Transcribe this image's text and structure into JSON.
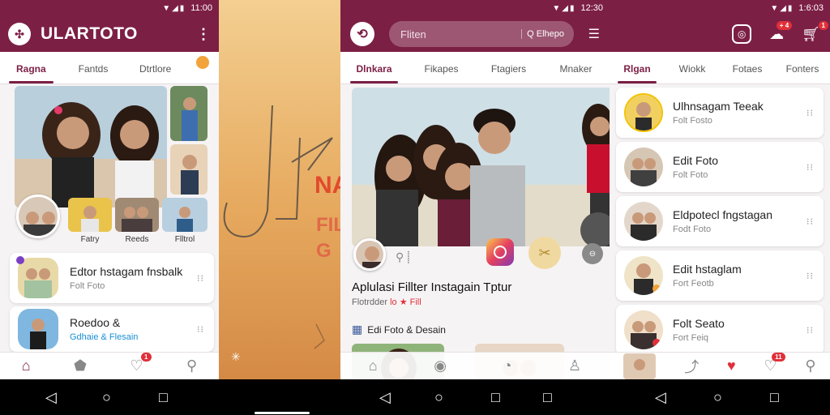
{
  "status": {
    "time_1": "11:00",
    "time_2": "12:30",
    "time_3": "1:6:03"
  },
  "colors": {
    "primary": "#7c1f45",
    "accent_orange": "#f2a33a",
    "badge_red": "#e0303a",
    "link_blue": "#1a8fd6"
  },
  "screen1": {
    "app_title": "ULARTOTO",
    "tabs": [
      "Ragna",
      "Fantds",
      "Dtrtlore"
    ],
    "thumbs": [
      "Fatry",
      "Reeds",
      "Flltrol"
    ],
    "cards": [
      {
        "title": "Edtor hstagam fnsbalk",
        "sub": "Folt Foto"
      },
      {
        "title": "Roedoo &",
        "sub": "Gdhaie & Flesain"
      }
    ],
    "notif": "1"
  },
  "splash": {
    "word": "NA",
    "word2": "FIL",
    "word3": "G"
  },
  "screen2": {
    "search_placeholder": "Fliten",
    "search_hint": "Q Elhepo",
    "tabs": [
      "Dlnkara",
      "Fikapes",
      "Ftagiers",
      "Mnaker"
    ],
    "heading": "Aplulasi Fillter Instagain Tptur",
    "subline": "Flotrdder",
    "subline_link": "lo ★ Fill",
    "section": "Edi Foto & Desain"
  },
  "screen3": {
    "tabs": [
      "Rlgan",
      "Wiokk",
      "Fotaes",
      "Fonters"
    ],
    "badge_top_1": "+ 4",
    "badge_top_2": "1",
    "notif": "11",
    "items": [
      {
        "title": "Ulhnsagam Teeak",
        "sub": "Folt Fosto"
      },
      {
        "title": "Edit Foto",
        "sub": "Folt Foto"
      },
      {
        "title": "Eldpotecl fngstagan",
        "sub": "Fodt Foto"
      },
      {
        "title": "Edit hstaglam",
        "sub": "Fort Feotb"
      },
      {
        "title": "Folt Seato",
        "sub": "Fort Feiq"
      }
    ]
  }
}
